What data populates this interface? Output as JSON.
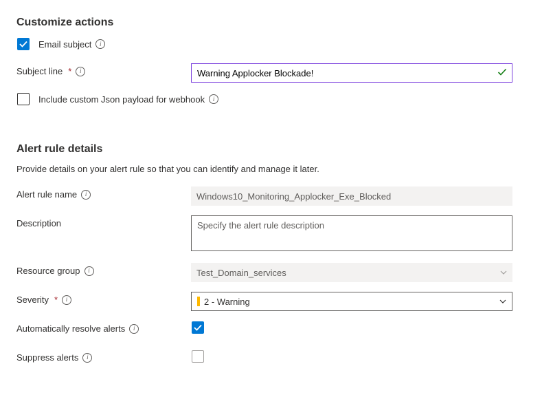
{
  "customize_actions": {
    "title": "Customize actions",
    "email_subject": {
      "label": "Email subject",
      "checked": true
    },
    "subject_line": {
      "label": "Subject line",
      "value": "Warning Applocker Blockade!",
      "required": true
    },
    "include_json": {
      "label": "Include custom Json payload for webhook",
      "checked": false
    }
  },
  "alert_rule_details": {
    "title": "Alert rule details",
    "intro": "Provide details on your alert rule so that you can identify and manage it later.",
    "alert_rule_name": {
      "label": "Alert rule name",
      "value": "Windows10_Monitoring_Applocker_Exe_Blocked"
    },
    "description": {
      "label": "Description",
      "placeholder": "Specify the alert rule description",
      "value": ""
    },
    "resource_group": {
      "label": "Resource group",
      "value": "Test_Domain_services"
    },
    "severity": {
      "label": "Severity",
      "value": "2 - Warning",
      "required": true
    },
    "auto_resolve": {
      "label": "Automatically resolve alerts",
      "checked": true
    },
    "suppress": {
      "label": "Suppress alerts",
      "checked": false
    }
  }
}
